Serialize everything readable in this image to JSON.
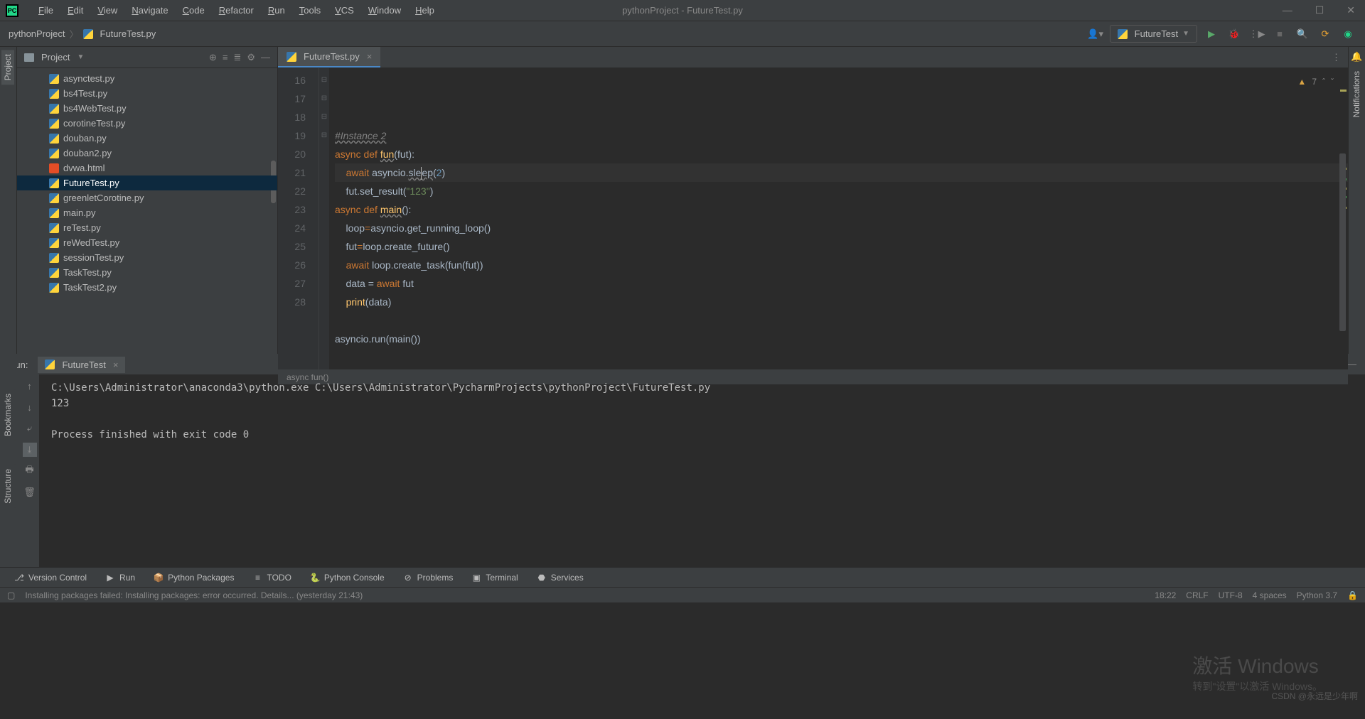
{
  "window": {
    "title": "pythonProject - FutureTest.py"
  },
  "menu": [
    "File",
    "Edit",
    "View",
    "Navigate",
    "Code",
    "Refactor",
    "Run",
    "Tools",
    "VCS",
    "Window",
    "Help"
  ],
  "breadcrumb": {
    "project": "pythonProject",
    "file": "FutureTest.py"
  },
  "runConfig": "FutureTest",
  "projectPanel": {
    "title": "Project",
    "files": [
      {
        "name": "asynctest.py",
        "type": "py"
      },
      {
        "name": "bs4Test.py",
        "type": "py"
      },
      {
        "name": "bs4WebTest.py",
        "type": "py"
      },
      {
        "name": "corotineTest.py",
        "type": "py"
      },
      {
        "name": "douban.py",
        "type": "py"
      },
      {
        "name": "douban2.py",
        "type": "py"
      },
      {
        "name": "dvwa.html",
        "type": "html"
      },
      {
        "name": "FutureTest.py",
        "type": "py",
        "selected": true
      },
      {
        "name": "greenletCorotine.py",
        "type": "py"
      },
      {
        "name": "main.py",
        "type": "py"
      },
      {
        "name": "reTest.py",
        "type": "py"
      },
      {
        "name": "reWedTest.py",
        "type": "py"
      },
      {
        "name": "sessionTest.py",
        "type": "py"
      },
      {
        "name": "TaskTest.py",
        "type": "py"
      },
      {
        "name": "TaskTest2.py",
        "type": "py"
      }
    ]
  },
  "editor": {
    "tabName": "FutureTest.py",
    "warnings": "7",
    "startLine": 16,
    "lines": [
      {
        "n": 16,
        "html": "<span class='cmt wavy'>#Instance 2</span>"
      },
      {
        "n": 17,
        "html": "<span class='kw'>async</span> <span class='kw'>def</span> <span class='fn wavy'>fun</span>(fut):",
        "fold": "⊟"
      },
      {
        "n": 18,
        "html": "    <span class='kw'>await</span> asyncio.<span class='wavy'>sle<span class='caret'></span>ep</span>(<span class='num'>2</span>)",
        "active": true
      },
      {
        "n": 19,
        "html": "    fut.set_result(<span class='str'>\"123\"</span>)",
        "fold": "⊟"
      },
      {
        "n": 20,
        "html": "<span class='kw'>async</span> <span class='kw'>def</span> <span class='fn wavy'>main</span>():",
        "fold": "⊟"
      },
      {
        "n": 21,
        "html": "    loop<span class='kw'>=</span>asyncio.get_running_loop()"
      },
      {
        "n": 22,
        "html": "    fut<span class='kw'>=</span>loop.create_future()"
      },
      {
        "n": 23,
        "html": "    <span class='kw'>await</span> loop.create_task(fun(fut))"
      },
      {
        "n": 24,
        "html": "    data = <span class='kw'>await</span> fut"
      },
      {
        "n": 25,
        "html": "    <span class='fn'>print</span>(data)",
        "fold": "⊟"
      },
      {
        "n": 26,
        "html": ""
      },
      {
        "n": 27,
        "html": "asyncio.run(main())"
      },
      {
        "n": 28,
        "html": ""
      }
    ],
    "breadcrumb": "async fun()"
  },
  "runPanel": {
    "label": "Run:",
    "tabName": "FutureTest",
    "output": "C:\\Users\\Administrator\\anaconda3\\python.exe C:\\Users\\Administrator\\PycharmProjects\\pythonProject\\FutureTest.py\n123\n\nProcess finished with exit code 0"
  },
  "leftTabs": {
    "project": "Project",
    "bookmarks": "Bookmarks",
    "structure": "Structure"
  },
  "rightTabs": {
    "notifications": "Notifications"
  },
  "bottomBar": [
    {
      "icon": "⎇",
      "label": "Version Control"
    },
    {
      "icon": "▶",
      "label": "Run"
    },
    {
      "icon": "📦",
      "label": "Python Packages"
    },
    {
      "icon": "≡",
      "label": "TODO"
    },
    {
      "icon": "🐍",
      "label": "Python Console"
    },
    {
      "icon": "⊘",
      "label": "Problems"
    },
    {
      "icon": "▣",
      "label": "Terminal"
    },
    {
      "icon": "⬣",
      "label": "Services"
    }
  ],
  "statusBar": {
    "message": "Installing packages failed: Installing packages: error occurred. Details... (yesterday 21:43)",
    "pos": "18:22",
    "eol": "CRLF",
    "enc": "UTF-8",
    "indent": "4 spaces",
    "interpreter": "Python 3.7"
  },
  "watermark": {
    "big": "激活 Windows",
    "small": "转到\"设置\"以激活 Windows。"
  },
  "csdn": "CSDN @永远是少年啊"
}
